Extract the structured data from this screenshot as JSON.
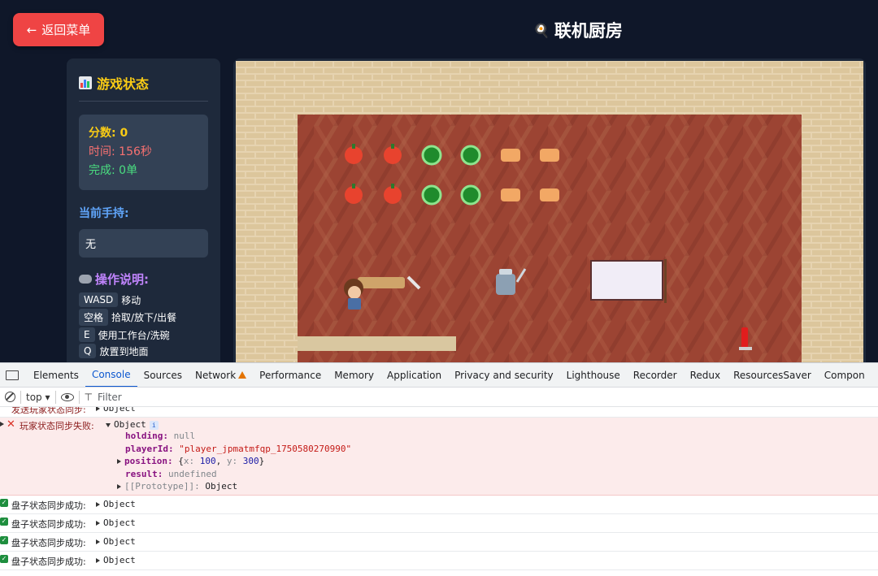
{
  "header": {
    "back_label": "返回菜单",
    "title": "联机厨房"
  },
  "status_panel": {
    "heading": "游戏状态",
    "score_label": "分数: 0",
    "time_label": "时间: 156秒",
    "done_label": "完成: 0单",
    "holding_heading": "当前手持:",
    "holding_value": "无",
    "controls_heading": "操作说明:",
    "controls": [
      {
        "key": "WASD",
        "desc": "移动"
      },
      {
        "key": "空格",
        "desc": "拾取/放下/出餐"
      },
      {
        "key": "E",
        "desc": "使用工作台/洗碗"
      },
      {
        "key": "Q",
        "desc": "放置到地面"
      }
    ]
  },
  "devtools": {
    "tabs": [
      "Elements",
      "Console",
      "Sources",
      "Network",
      "Performance",
      "Memory",
      "Application",
      "Privacy and security",
      "Lighthouse",
      "Recorder",
      "Redux",
      "ResourcesSaver",
      "Compon"
    ],
    "active_tab": "Console",
    "context": "top ▾",
    "filter_placeholder": "Filter",
    "partial_log": {
      "message": "发送玩家状态同步:",
      "value": "Object"
    },
    "error_log": {
      "message": "玩家状态同步失败:",
      "object_label": "Object",
      "info_badge": "i",
      "props": {
        "holding_key": "holding:",
        "holding_val": "null",
        "playerId_key": "playerId:",
        "playerId_val": "\"player_jpmatmfqp_1750580270990\"",
        "position_key": "position:",
        "position_open": "{",
        "position_x_key": "x:",
        "position_x_val": "100",
        "position_y_key": "y:",
        "position_y_val": "300",
        "position_close": "}",
        "result_key": "result:",
        "result_val": "undefined",
        "proto_key": "[[Prototype]]:",
        "proto_val": "Object"
      }
    },
    "success_logs": [
      {
        "message": "盘子状态同步成功:",
        "value": "Object"
      },
      {
        "message": "盘子状态同步成功:",
        "value": "Object"
      },
      {
        "message": "盘子状态同步成功:",
        "value": "Object"
      },
      {
        "message": "盘子状态同步成功:",
        "value": "Object"
      }
    ]
  }
}
